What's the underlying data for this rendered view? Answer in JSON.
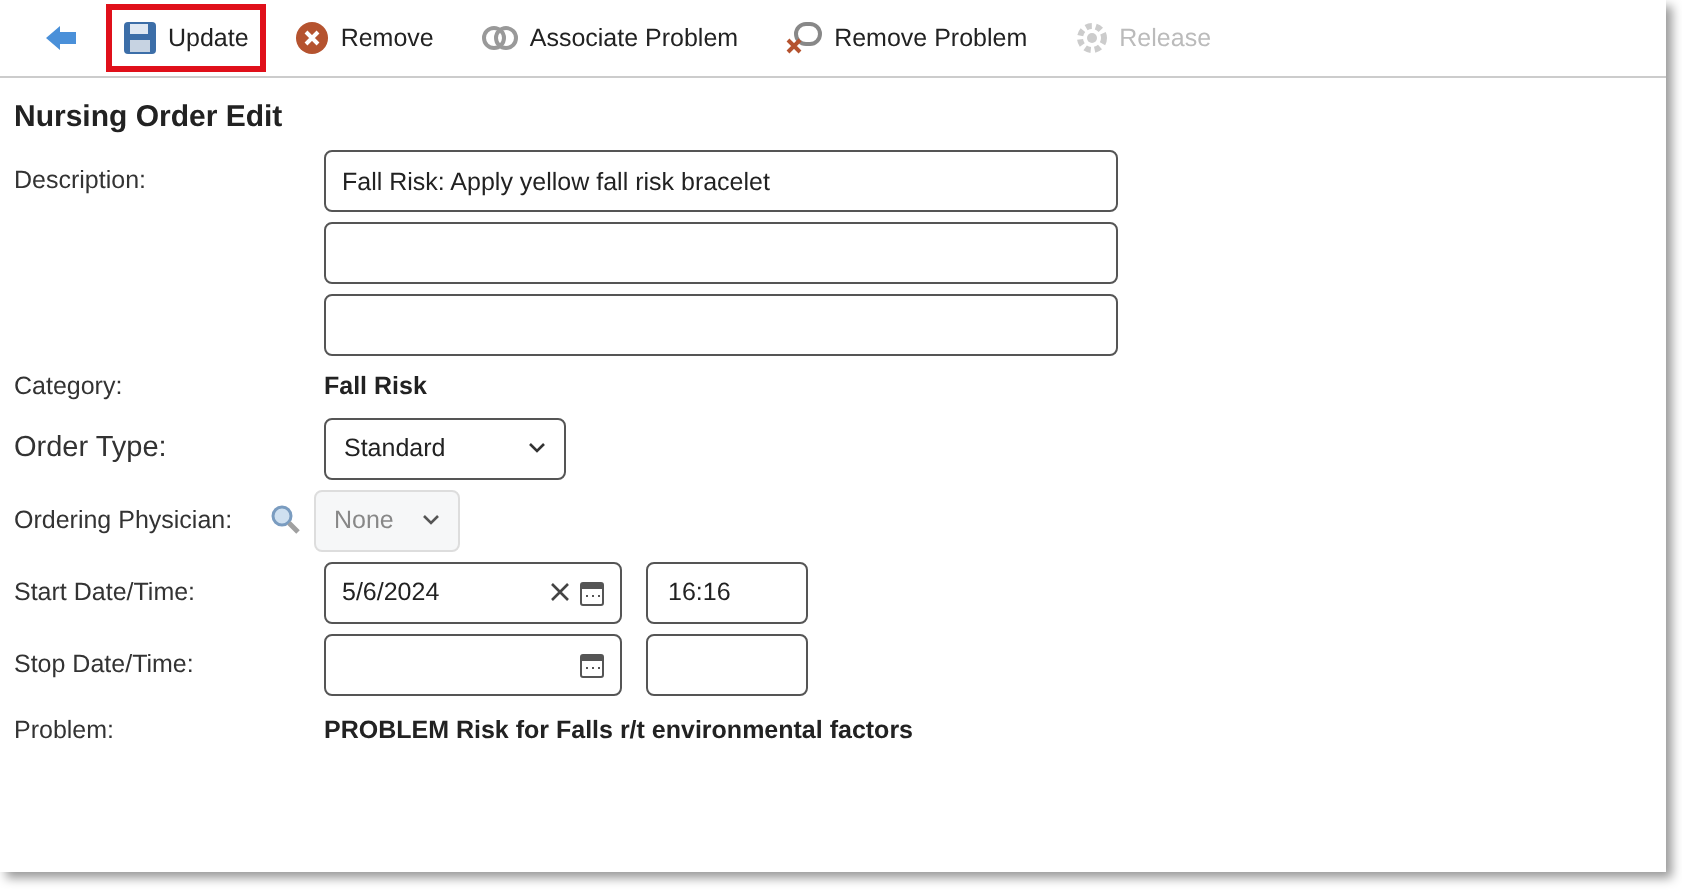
{
  "toolbar": [
    {
      "kind": "back"
    },
    {
      "kind": "save",
      "label": "Update",
      "highlighted": true,
      "disabled": false
    },
    {
      "kind": "remove",
      "label": "Remove",
      "highlighted": false,
      "disabled": false
    },
    {
      "kind": "link",
      "label": "Associate Problem",
      "highlighted": false,
      "disabled": false
    },
    {
      "kind": "unlink",
      "label": "Remove Problem",
      "highlighted": false,
      "disabled": false
    },
    {
      "kind": "gear",
      "label": "Release",
      "highlighted": false,
      "disabled": true
    }
  ],
  "title": "Nursing Order Edit",
  "description": {
    "label": "Description:",
    "fields": [
      {
        "kind": "text",
        "value": "Fall Risk: Apply yellow fall risk bracelet"
      },
      {
        "kind": "text"
      },
      {
        "kind": "text"
      }
    ]
  },
  "category": {
    "label": "Category:",
    "value": "Fall Risk"
  },
  "order_type": {
    "label": "Order Type:",
    "value": "Standard",
    "disabled": false
  },
  "physician": {
    "label": "Ordering Physician:",
    "value": "None",
    "disabled": true
  },
  "start": {
    "label": "Start Date/Time:",
    "date": "5/6/2024",
    "time": "16:16",
    "clearable": true
  },
  "stop": {
    "label": "Stop Date/Time:",
    "clearable": false
  },
  "problem": {
    "label": "Problem:",
    "value": "PROBLEM Risk for Falls r/t environmental factors"
  }
}
